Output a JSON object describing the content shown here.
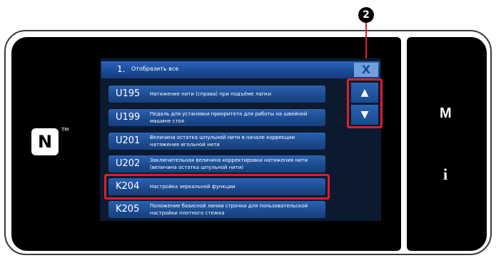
{
  "callout": {
    "number": "2"
  },
  "title": {
    "number": "1.",
    "text": "Отобразить все",
    "close": "X"
  },
  "rows": [
    {
      "code": "U195",
      "desc": "Натяжение нити (справа) при подъёме лапки"
    },
    {
      "code": "U199",
      "desc": "Педаль для установки приоритета для работы на швейной машине стоя"
    },
    {
      "code": "U201",
      "desc": "Величина остатка шпульной нити в начале коррекции натяжения игольной нити"
    },
    {
      "code": "U202",
      "desc": "Заключительная величина корректировки натяжения нити (величина остатка шпульной нити)"
    },
    {
      "code": "K204",
      "desc": "Настройка зеркальной функции"
    },
    {
      "code": "K205",
      "desc": "Положение базисной линии строчки для пользовательской настройки плотного стежка"
    }
  ],
  "scroll": {
    "up": "▲",
    "down": "▼"
  },
  "side": {
    "nfc": "N",
    "tm": "TM",
    "m": "M",
    "info": "i"
  }
}
